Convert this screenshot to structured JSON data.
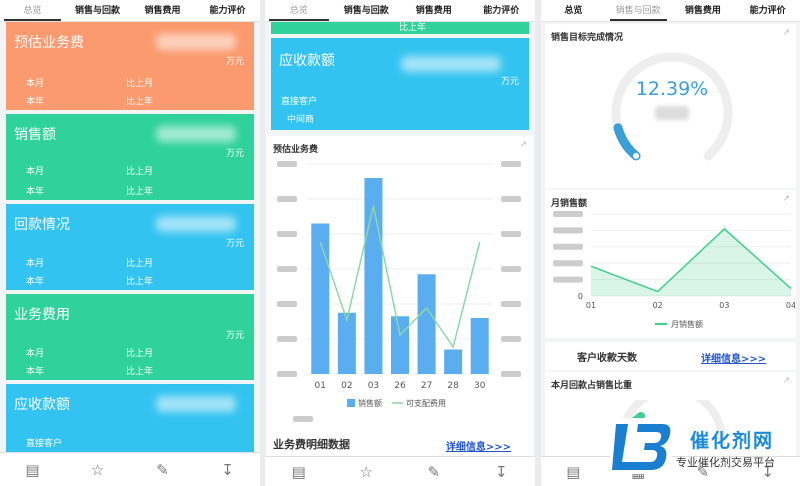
{
  "tabs": [
    "总览",
    "销售与回款",
    "销售费用",
    "能力评价"
  ],
  "panel1": {
    "cards": [
      {
        "title": "预估业务费",
        "unit": "万元",
        "row1": [
          "本月",
          "比上月"
        ],
        "row2": [
          "本年",
          "比上年"
        ],
        "color": "#fb9a6e"
      },
      {
        "title": "销售额",
        "unit": "万元",
        "row1": [
          "本月",
          "比上月"
        ],
        "row2": [
          "本年",
          "比上年"
        ],
        "color": "#2fd29b"
      },
      {
        "title": "回款情况",
        "unit": "万元",
        "row1": [
          "本月",
          "比上月"
        ],
        "row2": [
          "本年",
          "比上年"
        ],
        "color": "#33c3f0"
      },
      {
        "title": "业务费用",
        "unit": "万元",
        "row1": [
          "本月",
          "比上月"
        ],
        "row2": [
          "本年",
          "比上年"
        ],
        "color": "#2fd29b"
      },
      {
        "title": "应收款额",
        "row1": [
          "直接客户"
        ],
        "color": "#33c3f0"
      }
    ]
  },
  "panel2": {
    "top_card_partial": "比上年",
    "receivable": {
      "title": "应收款额",
      "unit": "万元",
      "row1": "直接客户",
      "row2": "中间商"
    },
    "fee_chart_title": "预估业务费",
    "detail_title": "业务费明细数据",
    "detail_link": "详细信息>>>"
  },
  "panel3": {
    "target_title": "销售目标完成情况",
    "target_percent": "12.39%",
    "target_progress": 0.1239,
    "monthly_title": "月销售额",
    "days_label": "客户收款天数",
    "days_link": "详细信息>>>",
    "ratio_title": "本月回款占销售比重"
  },
  "chart_data": [
    {
      "type": "bar",
      "title": "预估业务费",
      "categories": [
        "01",
        "02",
        "03",
        "26",
        "27",
        "28",
        "30"
      ],
      "series": [
        {
          "name": "销售额",
          "values": [
            430,
            175,
            560,
            165,
            285,
            70,
            160
          ],
          "color": "#5aaef0"
        },
        {
          "name": "可支配费用",
          "values": [
            2200,
            900,
            2800,
            650,
            1100,
            450,
            2200
          ],
          "color": "#8ed7a7"
        }
      ],
      "ylim": [
        0,
        600
      ],
      "y2lim": [
        0,
        3500
      ],
      "legend": "bottom"
    },
    {
      "type": "area",
      "title": "月销售额",
      "categories": [
        "01",
        "02",
        "03",
        "04"
      ],
      "series": [
        {
          "name": "月销售额",
          "values": [
            4000000,
            600000,
            9000000,
            1000000
          ],
          "color": "#3ecf8e"
        }
      ],
      "xlabel_ticks": [
        "01",
        "02",
        "03",
        "04"
      ],
      "y_ticks": [
        "0"
      ],
      "ylim": [
        0,
        11000000
      ],
      "legend": "bottom"
    }
  ],
  "watermark": {
    "title": "催化剂网",
    "subtitle": "专业催化剂交易平台"
  }
}
